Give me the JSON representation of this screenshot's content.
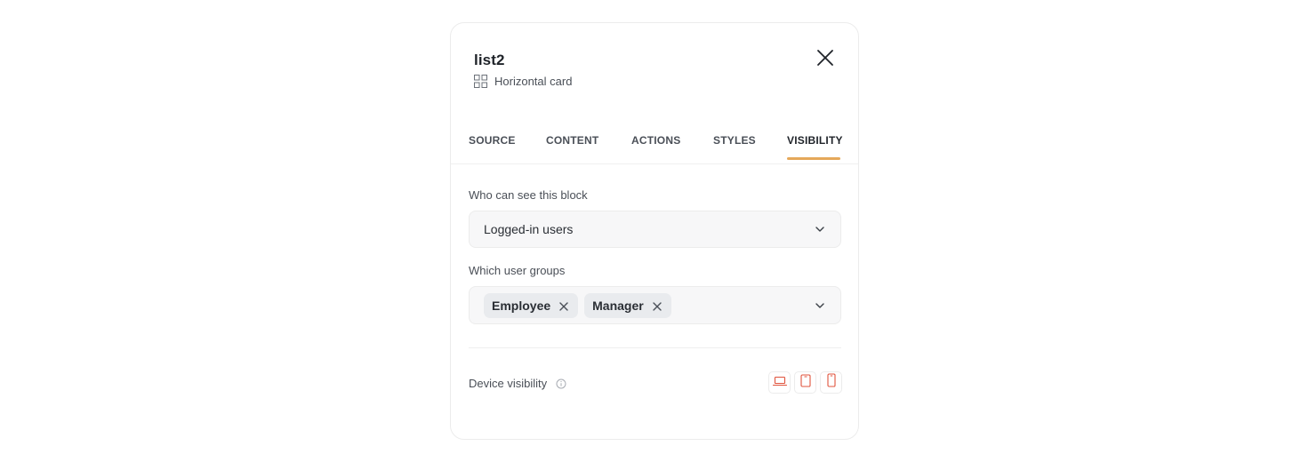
{
  "panel": {
    "title": "list2",
    "subtitle": "Horizontal card",
    "subtitle_icon": "grid-icon",
    "close_icon": "close-icon"
  },
  "tabs": [
    {
      "label": "SOURCE",
      "active": false
    },
    {
      "label": "CONTENT",
      "active": false
    },
    {
      "label": "ACTIONS",
      "active": false
    },
    {
      "label": "STYLES",
      "active": false
    },
    {
      "label": "VISIBILITY",
      "active": true
    }
  ],
  "visibility": {
    "who_label": "Who can see this block",
    "who_value": "Logged-in users",
    "groups_label": "Which user groups",
    "groups": [
      "Employee",
      "Manager"
    ],
    "device_label": "Device visibility",
    "devices": [
      "laptop-icon",
      "tablet-icon",
      "phone-icon"
    ]
  },
  "colors": {
    "accent": "#e5a85a",
    "device_icon": "#e0533c"
  }
}
